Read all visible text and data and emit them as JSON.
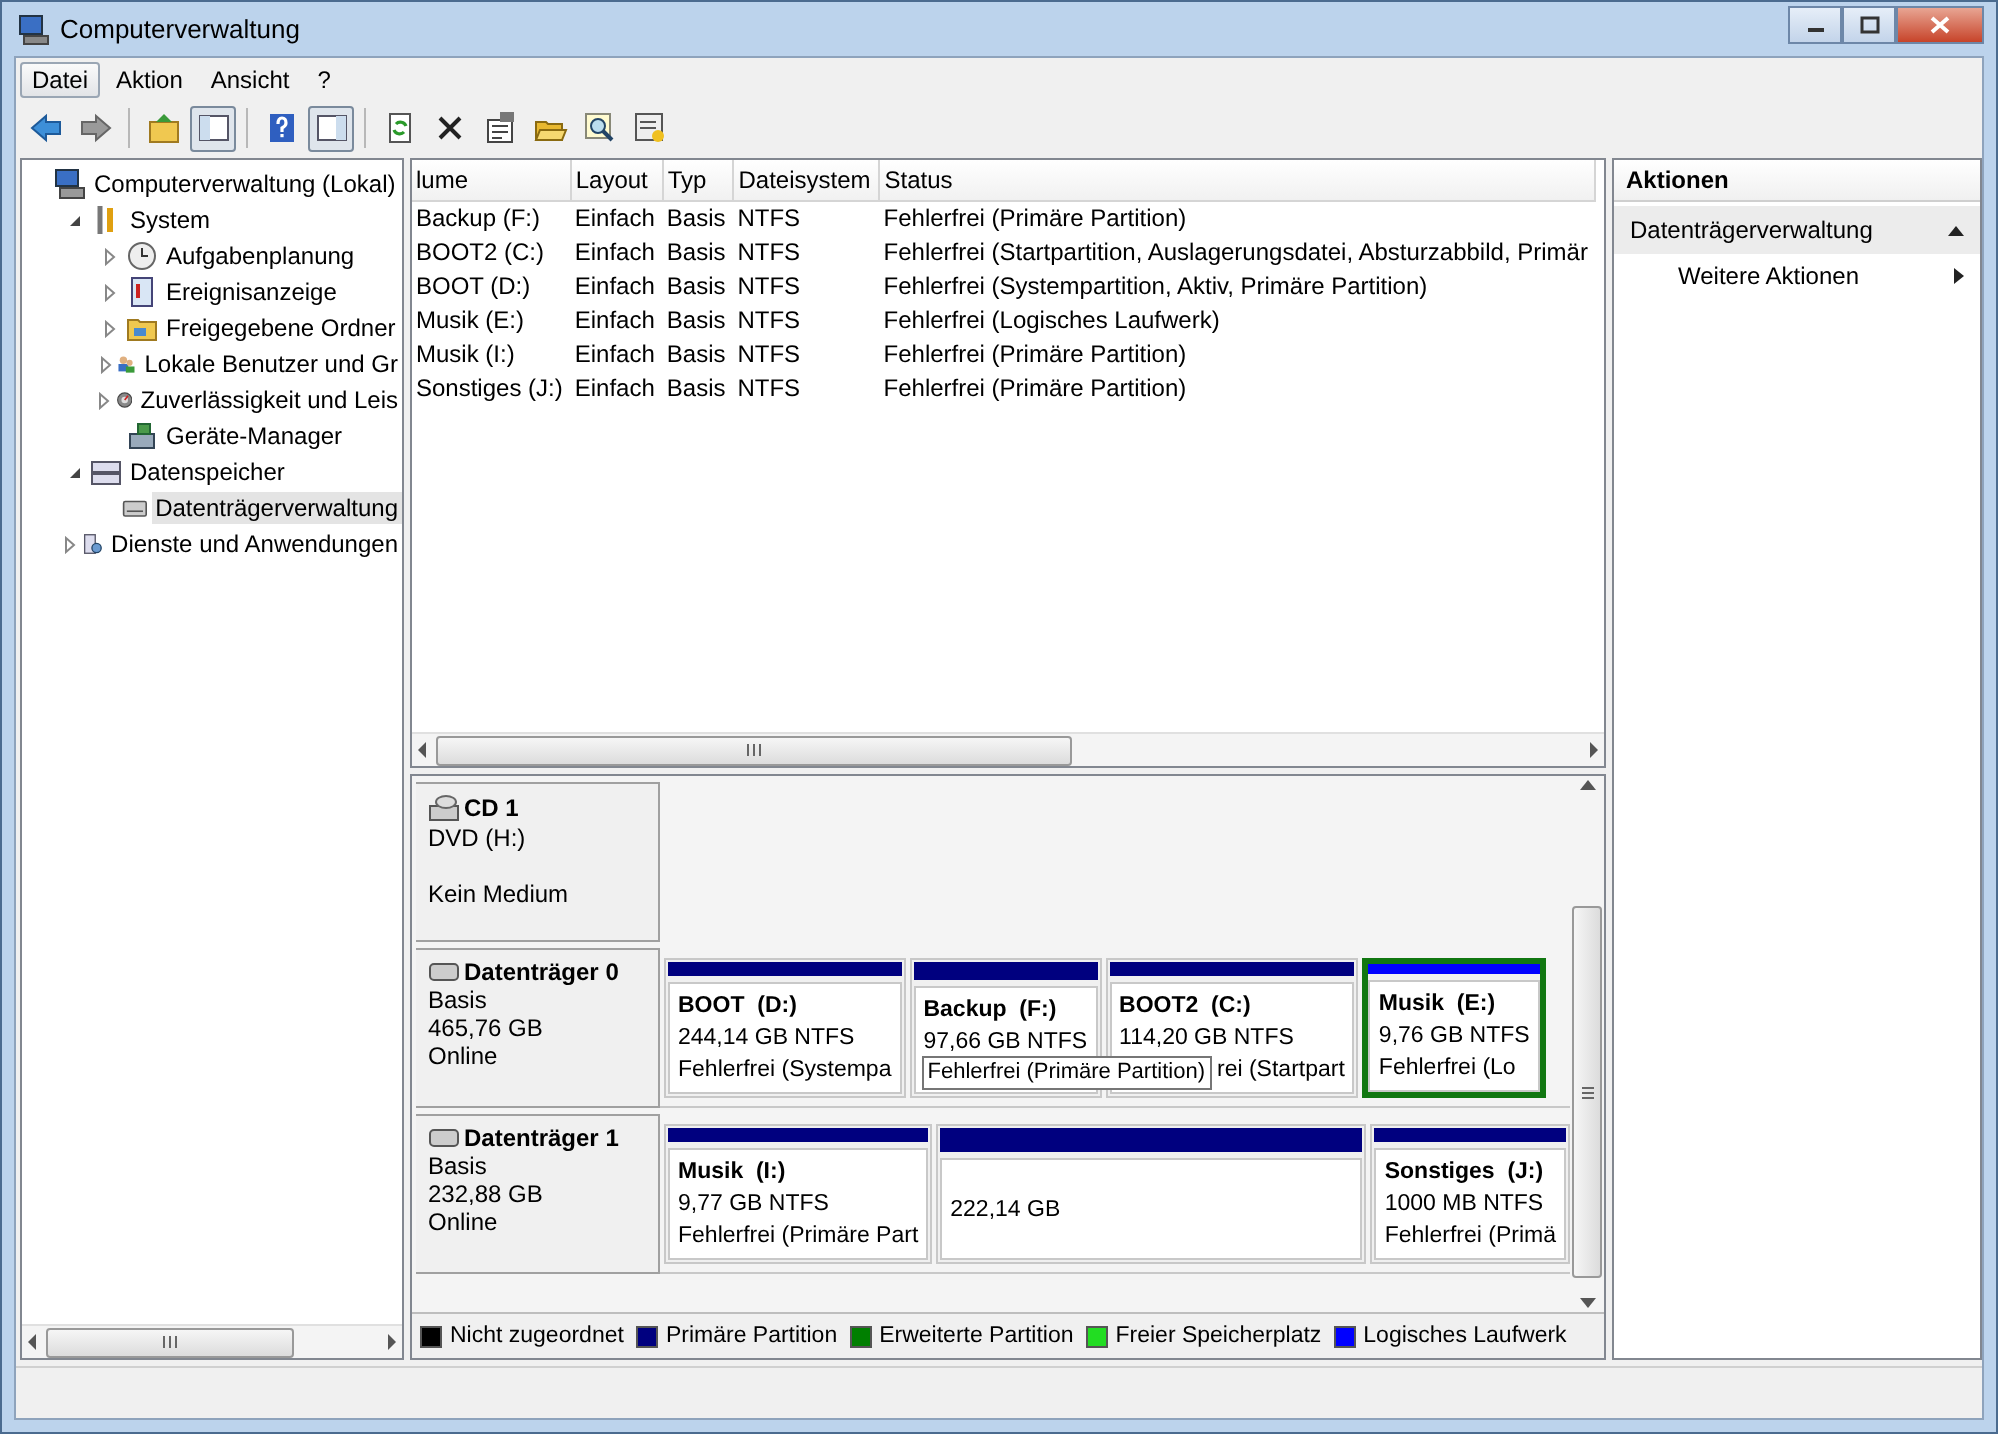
{
  "window": {
    "title": "Computerverwaltung"
  },
  "menu": [
    {
      "label": "Datei",
      "selected": true
    },
    {
      "label": "Aktion",
      "selected": false
    },
    {
      "label": "Ansicht",
      "selected": false
    },
    {
      "label": "?",
      "selected": false
    }
  ],
  "toolbar": [
    {
      "kind": "back",
      "pressed": false
    },
    {
      "kind": "forward",
      "pressed": false
    },
    {
      "kind": "separator"
    },
    {
      "kind": "up",
      "pressed": false
    },
    {
      "kind": "tree",
      "pressed": true
    },
    {
      "kind": "separator"
    },
    {
      "kind": "help",
      "pressed": false
    },
    {
      "kind": "pane",
      "pressed": true
    },
    {
      "kind": "separator"
    },
    {
      "kind": "refresh",
      "pressed": false
    },
    {
      "kind": "delete",
      "pressed": false
    },
    {
      "kind": "properties",
      "pressed": false
    },
    {
      "kind": "open",
      "pressed": false
    },
    {
      "kind": "search",
      "pressed": false
    },
    {
      "kind": "wizard",
      "pressed": false
    }
  ],
  "tree": [
    {
      "label": "Computerverwaltung (Lokal)",
      "kind": "computer",
      "selected": false,
      "children": [
        {
          "label": "System",
          "kind": "tools",
          "expanded": true,
          "selected": false,
          "children": [
            {
              "label": "Aufgabenplanung",
              "kind": "clock",
              "expanded": false,
              "selected": false
            },
            {
              "label": "Ereignisanzeige",
              "kind": "event",
              "expanded": false,
              "selected": false
            },
            {
              "label": "Freigegebene Ordner",
              "kind": "folder",
              "expanded": false,
              "selected": false
            },
            {
              "label": "Lokale Benutzer und Gr",
              "kind": "users",
              "expanded": false,
              "selected": false
            },
            {
              "label": "Zuverlässigkeit und Leis",
              "kind": "gauge",
              "expanded": false,
              "selected": false
            },
            {
              "label": "Geräte-Manager",
              "kind": "device",
              "selected": false
            }
          ]
        },
        {
          "label": "Datenspeicher",
          "kind": "storage",
          "expanded": true,
          "selected": false,
          "children": [
            {
              "label": "Datenträgerverwaltung",
              "kind": "disk",
              "selected": true
            }
          ]
        },
        {
          "label": "Dienste und Anwendungen",
          "kind": "services",
          "expanded": false,
          "selected": false
        }
      ]
    }
  ],
  "volume_table": {
    "columns": [
      "lume",
      "Layout",
      "Typ",
      "Dateisystem",
      "Status"
    ],
    "rows": [
      [
        "Backup (F:)",
        "Einfach",
        "Basis",
        "NTFS",
        "Fehlerfrei (Primäre Partition)"
      ],
      [
        "BOOT2 (C:)",
        "Einfach",
        "Basis",
        "NTFS",
        "Fehlerfrei (Startpartition, Auslagerungsdatei, Absturzabbild, Primär"
      ],
      [
        "BOOT (D:)",
        "Einfach",
        "Basis",
        "NTFS",
        "Fehlerfrei (Systempartition, Aktiv, Primäre Partition)"
      ],
      [
        "Musik (E:)",
        "Einfach",
        "Basis",
        "NTFS",
        "Fehlerfrei (Logisches Laufwerk)"
      ],
      [
        "Musik (I:)",
        "Einfach",
        "Basis",
        "NTFS",
        "Fehlerfrei (Primäre Partition)"
      ],
      [
        "Sonstiges (J:)",
        "Einfach",
        "Basis",
        "NTFS",
        "Fehlerfrei (Primäre Partition)"
      ]
    ]
  },
  "disks": [
    {
      "kind": "cd",
      "name": "CD 1",
      "type": "DVD (H:)",
      "status": "Kein Medium"
    },
    {
      "kind": "disk",
      "name": "Datenträger 0",
      "type": "Basis",
      "size": "465,76 GB",
      "status": "Online",
      "partitions": [
        {
          "name": "BOOT  (D:)",
          "size": "244,14 GB NTFS",
          "status": "Fehlerfrei (Systempa",
          "color": "#00007f",
          "selected": false
        },
        {
          "name": "Backup  (F:)",
          "size": "97,66 GB NTFS",
          "tooltip": "Fehlerfrei (Primäre Partition)",
          "color": "#00007f",
          "selected": false
        },
        {
          "name": "BOOT2  (C:)",
          "size": "114,20 GB NTFS",
          "status": "rei (Startpart",
          "color": "#00007f",
          "selected": false
        },
        {
          "name": "Musik  (E:)",
          "size": "9,76 GB NTFS",
          "status": "Fehlerfrei (Lo",
          "color": "#0000ff",
          "selected": true
        }
      ]
    },
    {
      "kind": "disk",
      "name": "Datenträger 1",
      "type": "Basis",
      "size": "232,88 GB",
      "status": "Online",
      "partitions": [
        {
          "name": "Musik  (I:)",
          "size": "9,77 GB NTFS",
          "status": "Fehlerfrei (Primäre Part",
          "color": "#00007f",
          "selected": false
        },
        {
          "size": "222,14 GB",
          "color": "#00007f",
          "selected": false
        },
        {
          "name": "Sonstiges  (J:)",
          "size": "1000 MB NTFS",
          "status": "Fehlerfrei (Primä",
          "color": "#00007f",
          "selected": false
        }
      ]
    }
  ],
  "legend": [
    {
      "label": "Nicht zugeordnet",
      "color": "#000000"
    },
    {
      "label": "Primäre Partition",
      "color": "#00007f"
    },
    {
      "label": "Erweiterte Partition",
      "color": "#007f00"
    },
    {
      "label": "Freier Speicherplatz",
      "color": "#22dd22"
    },
    {
      "label": "Logisches Laufwerk",
      "color": "#0000ff"
    }
  ],
  "actions": {
    "title": "Aktionen",
    "items": [
      {
        "kind": "group",
        "label": "Datenträgerverwaltung",
        "expanded": true
      },
      {
        "kind": "submenu",
        "label": "Weitere Aktionen"
      }
    ]
  }
}
